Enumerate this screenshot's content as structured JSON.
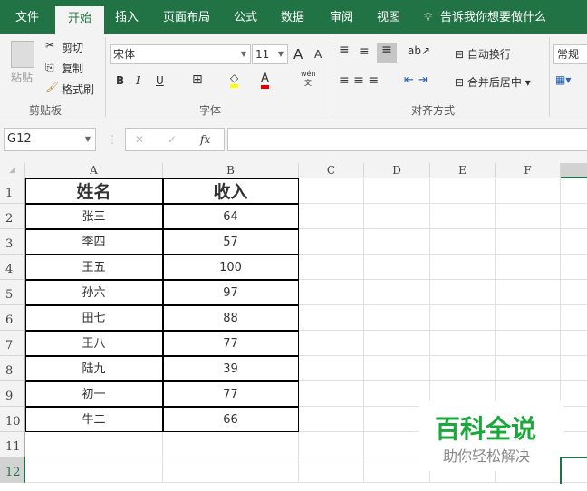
{
  "tabs": [
    "文件",
    "开始",
    "插入",
    "页面布局",
    "公式",
    "数据",
    "审阅",
    "视图",
    "告诉我你想要做什么"
  ],
  "ribbon": {
    "paste": "粘贴",
    "cut": "剪切",
    "copy": "复制",
    "format_painter": "格式刷",
    "clipboard_group": "剪贴板",
    "font_name": "宋体",
    "font_size": "11",
    "bold": "B",
    "italic": "I",
    "underline": "U",
    "font_group": "字体",
    "wrap": "自动换行",
    "merge": "合并后居中",
    "align_group": "对齐方式",
    "number_format": "常规",
    "phonetic_top": "wén",
    "phonetic_bottom": "文",
    "grow": "A",
    "shrink": "A",
    "font_color": "A"
  },
  "formula_bar": {
    "name_box": "G12",
    "fx": "fx",
    "cancel": "✕",
    "enter": "✓",
    "value": ""
  },
  "columns": [
    "A",
    "B",
    "C",
    "D",
    "E",
    "F"
  ],
  "rows": [
    "1",
    "2",
    "3",
    "4",
    "5",
    "6",
    "7",
    "8",
    "9",
    "10",
    "11",
    "12"
  ],
  "table": {
    "headers": [
      "姓名",
      "收入"
    ],
    "rows": [
      [
        "张三",
        "64"
      ],
      [
        "李四",
        "57"
      ],
      [
        "王五",
        "100"
      ],
      [
        "孙六",
        "97"
      ],
      [
        "田七",
        "88"
      ],
      [
        "王八",
        "77"
      ],
      [
        "陆九",
        "39"
      ],
      [
        "初一",
        "77"
      ],
      [
        "牛二",
        "66"
      ]
    ]
  },
  "watermark": {
    "title": "百科全说",
    "subtitle": "助你轻松解决"
  },
  "colors": {
    "accent": "#217346",
    "watermark": "#1aa83a"
  }
}
